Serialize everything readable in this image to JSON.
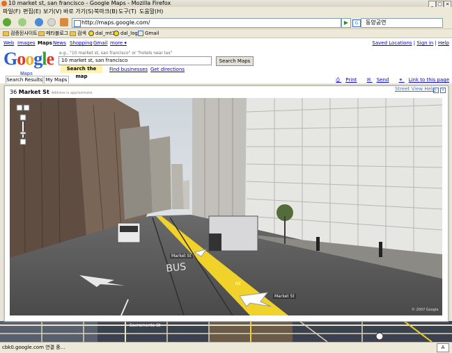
{
  "window": {
    "title": "10 market st, san francisco - Google Maps - Mozilla Firefox"
  },
  "menu": [
    "파일(F)",
    "편집(E)",
    "보기(V)",
    "바로 가기(S)",
    "북마크(B)",
    "도구(T)",
    "도움말(H)"
  ],
  "toolbar": {
    "url": "http://maps.google.com/",
    "search_value": "동양공연"
  },
  "bookmarks": [
    {
      "label": "검증된사이트",
      "icon": "folder-icon"
    },
    {
      "label": "메타블로그",
      "icon": "folder-icon"
    },
    {
      "label": "검색",
      "icon": "folder-icon"
    },
    {
      "label": "dal_mt3",
      "icon": "dot-icon"
    },
    {
      "label": "dal_log",
      "icon": "dot-icon"
    },
    {
      "label": "Gmail",
      "icon": "gmail-icon"
    }
  ],
  "gnav": {
    "links": [
      "Web",
      "Images",
      "Maps",
      "News",
      "Shopping",
      "Gmail",
      "more ▾"
    ],
    "right": [
      "Saved Locations",
      "Sign in",
      "Help"
    ]
  },
  "search": {
    "logo": "Google",
    "logo_sub": "Maps",
    "hint": "e.g., \"10 market st, san francisco\" or \"hotels near lax\"",
    "query": "10 market st, san francisco",
    "button": "Search Maps",
    "tabs": [
      "Search the map",
      "Find businesses",
      "Get directions"
    ]
  },
  "result_tabs": [
    "Search Results",
    "My Maps"
  ],
  "tools": [
    "Print",
    "Send",
    "Link to this page"
  ],
  "streetview": {
    "number": "36",
    "street": "Market St",
    "note": "Address is approximate",
    "help": "Street View Help",
    "label1": "Market St",
    "label2": "Market St",
    "compass": "NE",
    "copyright": "© 2007 Google"
  },
  "map_labels": [
    "Sacramento St"
  ],
  "status": {
    "text": "cbk0.google.com 연결 중...",
    "indicator": "A"
  },
  "colors": {
    "chrome": "#ece9d8",
    "link": "#0000cc",
    "highlight": "#fff3b0",
    "street_line": "#f0d22a"
  }
}
